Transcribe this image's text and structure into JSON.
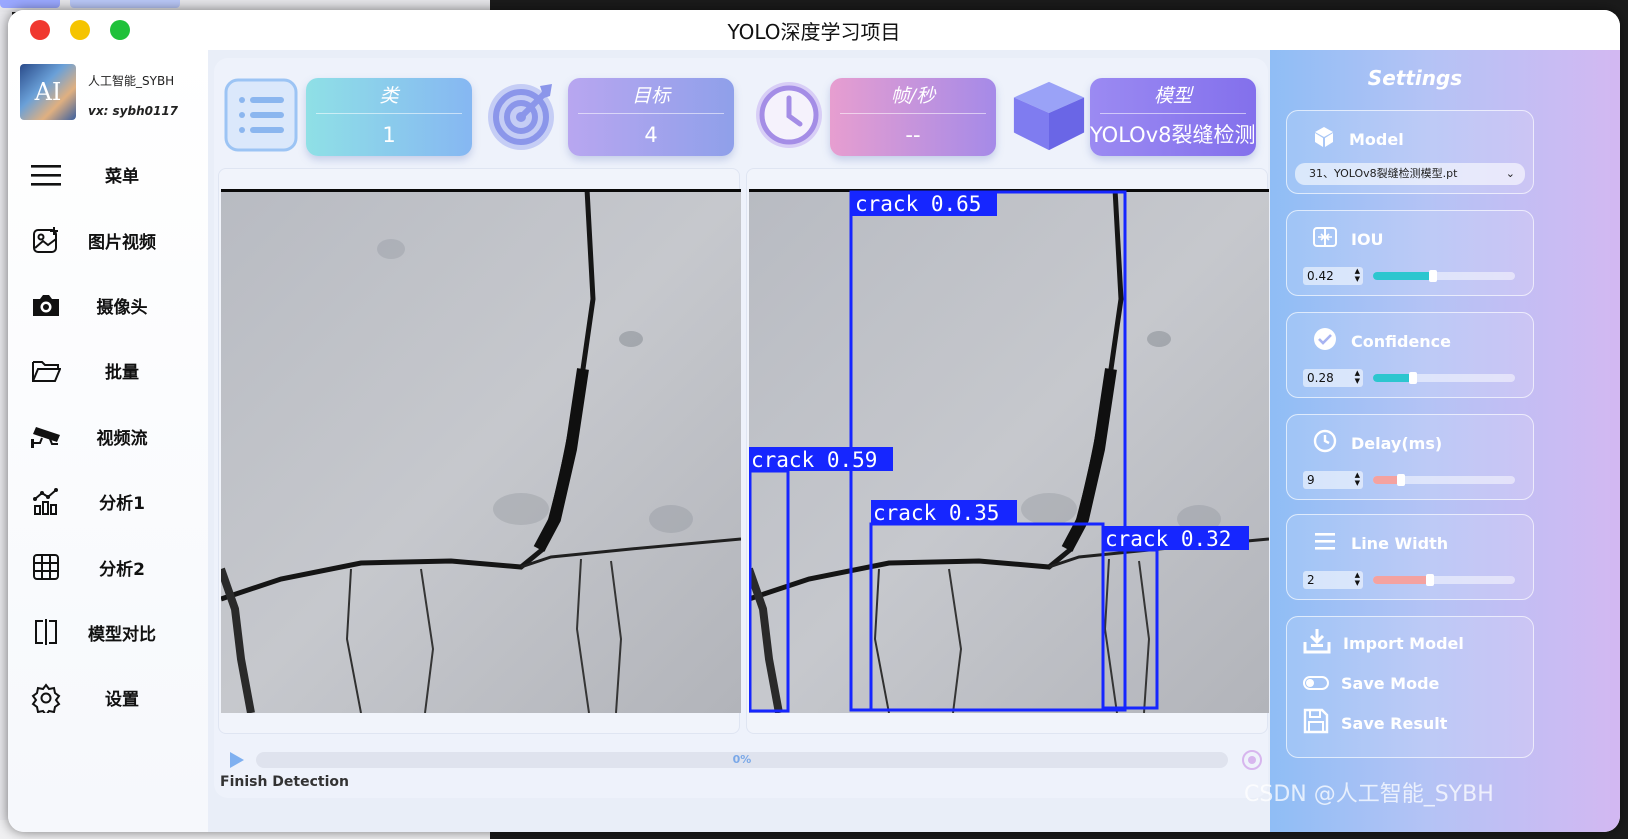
{
  "window": {
    "title": "YOLO深度学习项目"
  },
  "profile": {
    "avatar_text": "AI",
    "name": "人工智能_SYBH",
    "wx": "vx: sybh0117"
  },
  "nav": [
    {
      "label": "菜单",
      "icon": "menu-icon"
    },
    {
      "label": "图片视频",
      "icon": "image-icon"
    },
    {
      "label": "摄像头",
      "icon": "camera-icon"
    },
    {
      "label": "批量",
      "icon": "folder-icon"
    },
    {
      "label": "视频流",
      "icon": "cctv-icon"
    },
    {
      "label": "分析1",
      "icon": "chart-icon"
    },
    {
      "label": "分析2",
      "icon": "table-icon"
    },
    {
      "label": "模型对比",
      "icon": "compare-icon"
    },
    {
      "label": "设置",
      "icon": "gear-icon"
    }
  ],
  "stats": {
    "classes": {
      "label": "类",
      "value": "1"
    },
    "targets": {
      "label": "目标",
      "value": "4"
    },
    "fps": {
      "label": "帧/秒",
      "value": "--"
    },
    "model": {
      "label": "模型",
      "value": "YOLOv8裂缝检测模"
    }
  },
  "detections": [
    {
      "label": "crack 0.65",
      "confidence": 0.65
    },
    {
      "label": "crack 0.59",
      "confidence": 0.59
    },
    {
      "label": "crack 0.35",
      "confidence": 0.35
    },
    {
      "label": "crack 0.32",
      "confidence": 0.32
    }
  ],
  "progress": {
    "value": 0,
    "text": "0%"
  },
  "status": "Finish Detection",
  "settings": {
    "title": "Settings",
    "model": {
      "label": "Model",
      "selected": "31、YOLOv8裂缝检测模型.pt"
    },
    "iou": {
      "label": "IOU",
      "value": "0.42",
      "fraction": 0.42
    },
    "confidence": {
      "label": "Confidence",
      "value": "0.28",
      "fraction": 0.28
    },
    "delay": {
      "label": "Delay(ms)",
      "value": "9",
      "fraction": 0.2
    },
    "line_width": {
      "label": "Line Width",
      "value": "2",
      "fraction": 0.4
    },
    "import_model": "Import Model",
    "save_mode": "Save Mode",
    "save_result": "Save Result"
  },
  "watermark": "CSDN @人工智能_SYBH",
  "colors": {
    "box": "#1626ff",
    "accent": "#7b8cf0"
  }
}
